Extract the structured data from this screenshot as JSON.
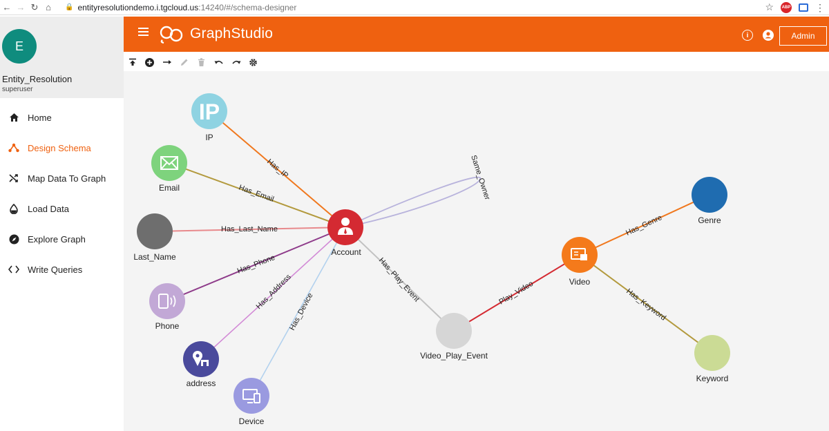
{
  "browser": {
    "url_host": "entityresolutiondemo.i.tgcloud.us",
    "url_path": ":14240/#/schema-designer",
    "abp_label": "ABP"
  },
  "app": {
    "logo_text_1": "Graph",
    "logo_text_2": "Studio",
    "admin_label": "Admin",
    "info_glyph": "i",
    "colors": {
      "header": "#ef6110",
      "active": "#ef6110",
      "canvas": "#f4f4f4",
      "avatar": "#0f8c7e"
    }
  },
  "profile": {
    "initial": "E",
    "name": "Entity_Resolution",
    "role": "superuser"
  },
  "sidebar": {
    "items": [
      {
        "label": "Home",
        "icon": "home-icon"
      },
      {
        "label": "Design Schema",
        "icon": "schema-icon",
        "active": true
      },
      {
        "label": "Map Data To Graph",
        "icon": "shuffle-icon"
      },
      {
        "label": "Load Data",
        "icon": "drop-icon"
      },
      {
        "label": "Explore Graph",
        "icon": "compass-icon"
      },
      {
        "label": "Write Queries",
        "icon": "code-icon"
      }
    ]
  },
  "toolbar": {
    "items": [
      "publish-icon",
      "add-vertex-icon",
      "add-edge-icon",
      "edit-icon",
      "delete-icon",
      "undo-icon",
      "redo-icon",
      "settings-icon"
    ]
  },
  "schema": {
    "vertices": [
      {
        "id": "ip",
        "label": "IP",
        "color": "#8fd3e2",
        "icon": "ip-icon"
      },
      {
        "id": "email",
        "label": "Email",
        "color": "#7ed37d",
        "icon": "email-icon"
      },
      {
        "id": "last_name",
        "label": "Last_Name",
        "color": "#6e6e6e",
        "icon": ""
      },
      {
        "id": "phone",
        "label": "Phone",
        "color": "#c2a8d6",
        "icon": "phone-icon"
      },
      {
        "id": "address",
        "label": "address",
        "color": "#4a4a9c",
        "icon": "address-icon"
      },
      {
        "id": "device",
        "label": "Device",
        "color": "#9a9ae0",
        "icon": "device-icon"
      },
      {
        "id": "account",
        "label": "Account",
        "color": "#d42a32",
        "icon": "account-icon"
      },
      {
        "id": "vpe",
        "label": "Video_Play_Event",
        "color": "#d6d6d6",
        "icon": ""
      },
      {
        "id": "video",
        "label": "Video",
        "color": "#f47a1b",
        "icon": "video-icon"
      },
      {
        "id": "genre",
        "label": "Genre",
        "color": "#1f6cb0",
        "icon": ""
      },
      {
        "id": "keyword",
        "label": "Keyword",
        "color": "#cbdb95",
        "icon": ""
      }
    ],
    "edges": [
      {
        "label": "Has_IP",
        "color": "#f0781e"
      },
      {
        "label": "Has_Email",
        "color": "#b39a3e"
      },
      {
        "label": "Has_Last_Name",
        "color": "#e8898c"
      },
      {
        "label": "Has_Phone",
        "color": "#8e3b8a"
      },
      {
        "label": "Has_Address",
        "color": "#d28ad6"
      },
      {
        "label": "Has_Device",
        "color": "#b2d1ee"
      },
      {
        "label": "Same_Owner",
        "color": "#b8b3dc"
      },
      {
        "label": "Has_Play_Event",
        "color": "#c2c2c2"
      },
      {
        "label": "Play_Video",
        "color": "#d42a32"
      },
      {
        "label": "Has_Genre",
        "color": "#f0781e"
      },
      {
        "label": "Has_Keyword",
        "color": "#b39a3e"
      }
    ]
  }
}
